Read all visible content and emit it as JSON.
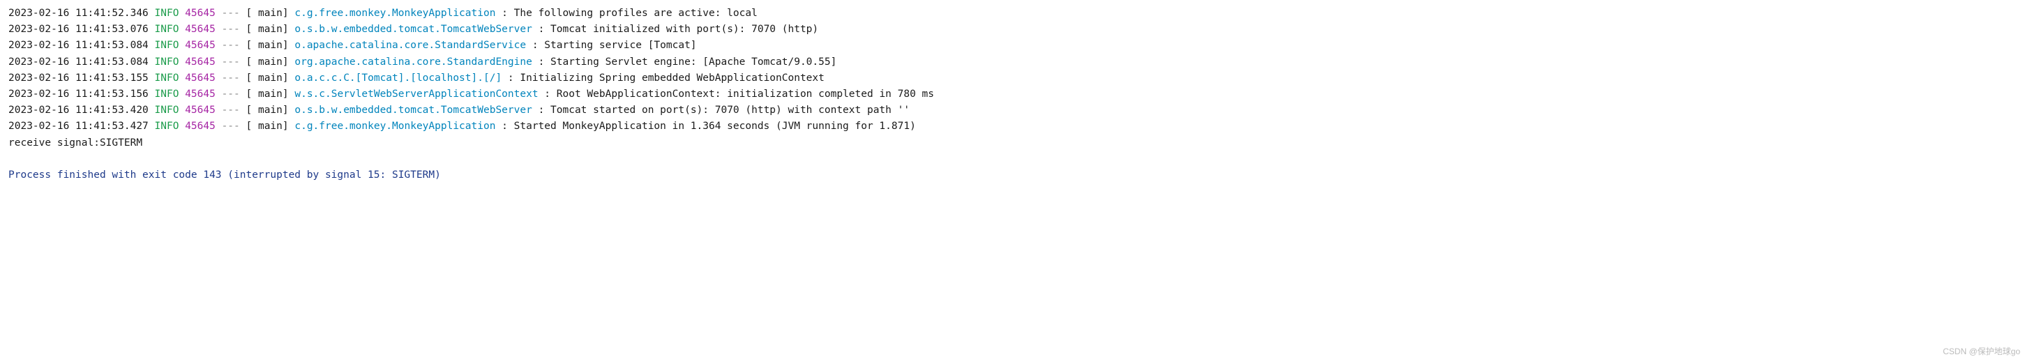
{
  "logs": [
    {
      "ts": "2023-02-16 11:41:52.346",
      "level": "INFO",
      "pid": "45645",
      "sep": "---",
      "threadPad": "[           main]",
      "logger": "c.g.free.monkey.MonkeyApplication       ",
      "msg": "The following profiles are active: local"
    },
    {
      "ts": "2023-02-16 11:41:53.076",
      "level": "INFO",
      "pid": "45645",
      "sep": "---",
      "threadPad": "[           main]",
      "logger": "o.s.b.w.embedded.tomcat.TomcatWebServer ",
      "msg": "Tomcat initialized with port(s): 7070 (http)"
    },
    {
      "ts": "2023-02-16 11:41:53.084",
      "level": "INFO",
      "pid": "45645",
      "sep": "---",
      "threadPad": "[           main]",
      "logger": "o.apache.catalina.core.StandardService  ",
      "msg": "Starting service [Tomcat]"
    },
    {
      "ts": "2023-02-16 11:41:53.084",
      "level": "INFO",
      "pid": "45645",
      "sep": "---",
      "threadPad": "[           main]",
      "logger": "org.apache.catalina.core.StandardEngine ",
      "msg": "Starting Servlet engine: [Apache Tomcat/9.0.55]"
    },
    {
      "ts": "2023-02-16 11:41:53.155",
      "level": "INFO",
      "pid": "45645",
      "sep": "---",
      "threadPad": "[           main]",
      "logger": "o.a.c.c.C.[Tomcat].[localhost].[/]      ",
      "msg": "Initializing Spring embedded WebApplicationContext"
    },
    {
      "ts": "2023-02-16 11:41:53.156",
      "level": "INFO",
      "pid": "45645",
      "sep": "---",
      "threadPad": "[           main]",
      "logger": "w.s.c.ServletWebServerApplicationContext",
      "msg": "Root WebApplicationContext: initialization completed in 780 ms"
    },
    {
      "ts": "2023-02-16 11:41:53.420",
      "level": "INFO",
      "pid": "45645",
      "sep": "---",
      "threadPad": "[           main]",
      "logger": "o.s.b.w.embedded.tomcat.TomcatWebServer ",
      "msg": "Tomcat started on port(s): 7070 (http) with context path ''"
    },
    {
      "ts": "2023-02-16 11:41:53.427",
      "level": "INFO",
      "pid": "45645",
      "sep": "---",
      "threadPad": "[           main]",
      "logger": "c.g.free.monkey.MonkeyApplication       ",
      "msg": "Started MonkeyApplication in 1.364 seconds (JVM running for 1.871)"
    }
  ],
  "signalLine": "receive signal:SIGTERM",
  "exitLine": "Process finished with exit code 143 (interrupted by signal 15: SIGTERM)",
  "watermark": "CSDN @保护地球go"
}
